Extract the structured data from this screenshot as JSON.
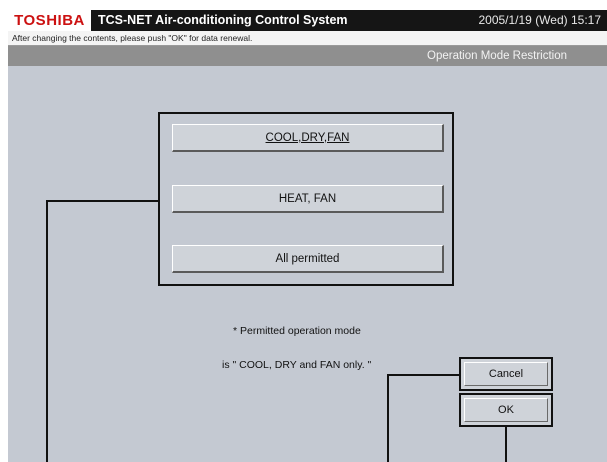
{
  "header": {
    "brand": "TOSHIBA",
    "app_title": "TCS-NET Air-conditioning Control System",
    "datetime": "2005/1/19 (Wed) 15:17"
  },
  "info_message": "After changing the contents, please push \"OK\" for data renewal.",
  "screen_title": "Operation Mode Restriction",
  "mode_options": [
    {
      "label": "COOL,DRY,FAN",
      "selected": true
    },
    {
      "label": "HEAT, FAN",
      "selected": false
    },
    {
      "label": "All permitted",
      "selected": false
    }
  ],
  "note": {
    "line1": "* Permitted operation mode",
    "line2": "is \" COOL, DRY and FAN only. \""
  },
  "buttons": {
    "cancel": "Cancel",
    "ok": "OK"
  }
}
